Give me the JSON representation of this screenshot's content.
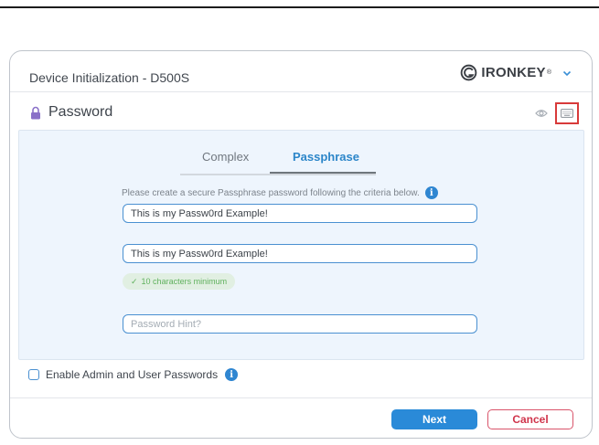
{
  "window": {
    "title": "Device Initialization - D500S",
    "brand": {
      "name": "IRONKEY",
      "mark": "®"
    }
  },
  "section": {
    "title": "Password"
  },
  "tabs": [
    {
      "label": "Complex",
      "active": false
    },
    {
      "label": "Passphrase",
      "active": true
    }
  ],
  "form": {
    "instruction": "Please create a secure Passphrase password following the criteria below.",
    "password_value": "This is my Passw0rd Example!",
    "confirm_value": "This is my Passw0rd Example!",
    "criteria": "10 characters minimum",
    "hint_placeholder": "Password Hint?"
  },
  "options": {
    "admin_user_label": "Enable Admin and User Passwords"
  },
  "buttons": {
    "next": "Next",
    "cancel": "Cancel"
  },
  "colors": {
    "accent": "#2a8ad8",
    "cancel": "#d0344b",
    "success": "#5fb15d",
    "highlight_box": "#d83a3a",
    "panel_bg": "#eef5fd"
  },
  "icons": {
    "lock": "lock-icon",
    "eye": "eye-icon",
    "keyboard": "keyboard-icon",
    "info": "info-icon",
    "check": "check-icon",
    "chevron": "chevron-down-icon"
  }
}
